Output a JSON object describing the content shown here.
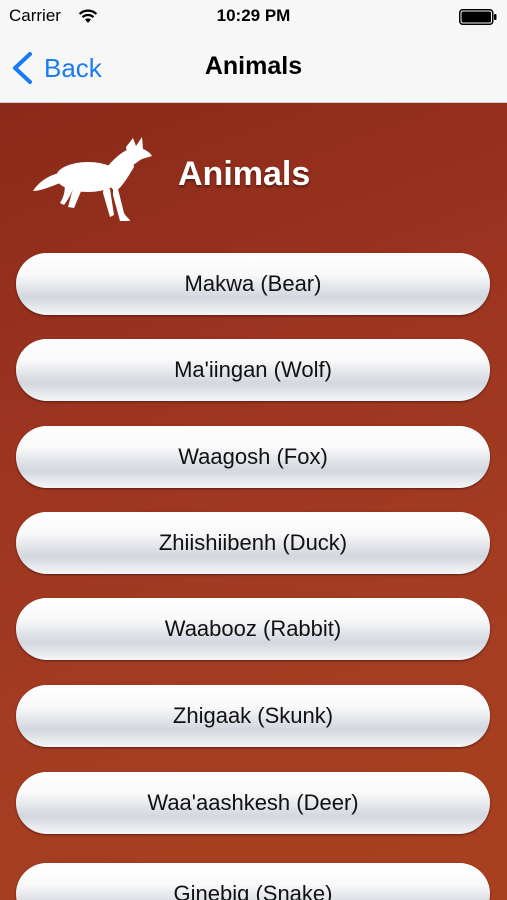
{
  "status_bar": {
    "carrier": "Carrier",
    "time": "10:29 PM"
  },
  "nav": {
    "back_label": "Back",
    "title": "Animals"
  },
  "header": {
    "title": "Animals",
    "icon": "fox-silhouette-icon"
  },
  "animals": [
    "Makwa (Bear)",
    "Ma'iingan (Wolf)",
    "Waagosh (Fox)",
    "Zhiishiibenh (Duck)",
    "Waabooz (Rabbit)",
    "Zhigaak (Skunk)",
    "Waa'aashkesh (Deer)",
    "Ginebig (Snake)"
  ],
  "colors": {
    "accent": "#1a7cf5",
    "background": "#9c3420",
    "button": "#e6e9ed"
  }
}
